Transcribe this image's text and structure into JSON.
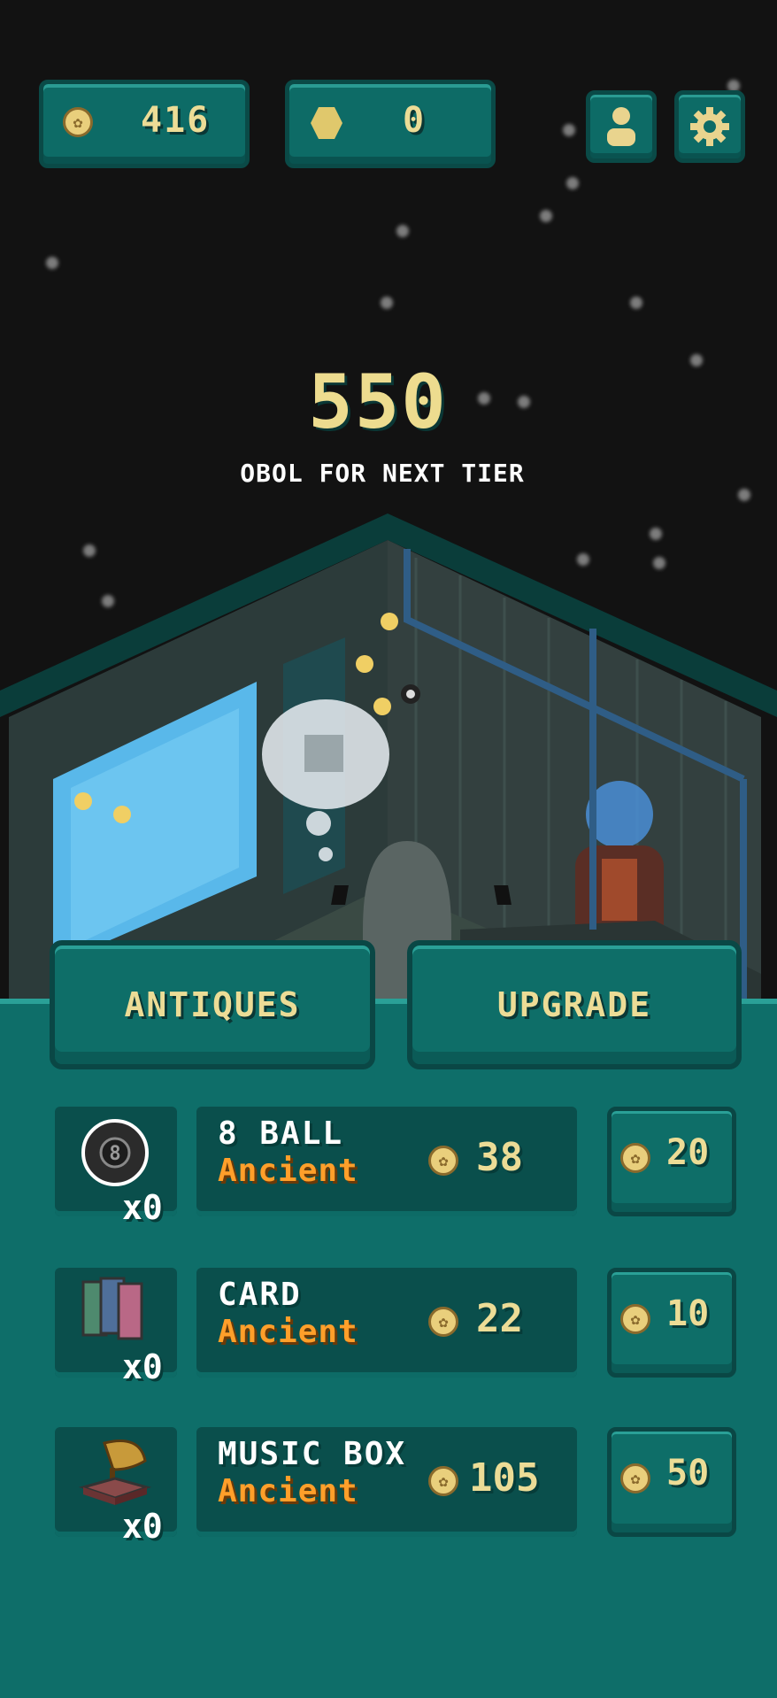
{
  "hud": {
    "obol_count": "416",
    "gem_count": "0",
    "profile_icon": "person-icon",
    "settings_icon": "gear-icon"
  },
  "tier": {
    "value": "550",
    "caption": "OBOL FOR NEXT TIER"
  },
  "tabs": {
    "antiques": "ANTIQUES",
    "upgrade": "UPGRADE"
  },
  "items": [
    {
      "name": "8 BALL",
      "rarity": "Ancient",
      "value": "38",
      "quantity": "x0",
      "buy_price": "20",
      "icon": "eight-ball-icon"
    },
    {
      "name": "CARD",
      "rarity": "Ancient",
      "value": "22",
      "quantity": "x0",
      "buy_price": "10",
      "icon": "cards-icon"
    },
    {
      "name": "MUSIC BOX",
      "rarity": "Ancient",
      "value": "105",
      "quantity": "x0",
      "buy_price": "50",
      "icon": "gramophone-icon"
    }
  ],
  "colors": {
    "background": "#121212",
    "panel": "#0d6b66",
    "panel_dark": "#0a4a47",
    "gold_text": "#ecdc96",
    "rarity_orange": "#ff9f2a"
  }
}
